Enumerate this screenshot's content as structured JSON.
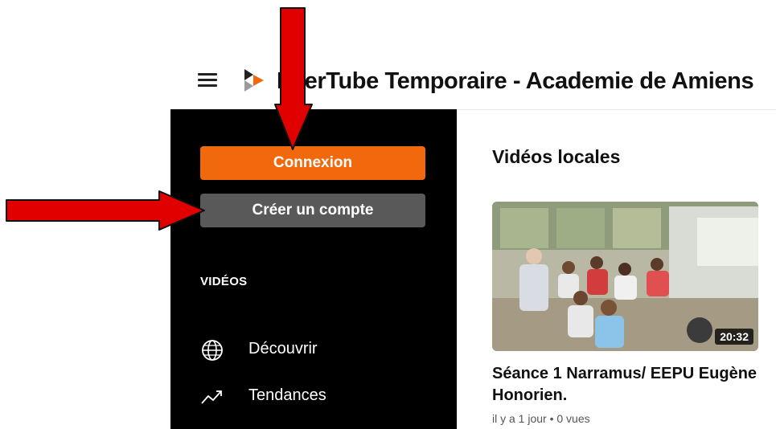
{
  "header": {
    "menu_icon": "hamburger-menu-icon",
    "logo_icon": "peertube-logo-icon",
    "title": "PeerTube Temporaire - Academie de Amiens"
  },
  "sidebar": {
    "login_label": "Connexion",
    "register_label": "Créer un compte",
    "section_title": "VIDÉOS",
    "items": [
      {
        "label": "Découvrir",
        "icon": "globe-icon"
      },
      {
        "label": "Tendances",
        "icon": "trending-up-icon"
      }
    ]
  },
  "main": {
    "heading": "Vidéos locales",
    "video": {
      "duration": "20:32",
      "title": "Séance 1 Narramus/ EEPU Eugène Honorien.",
      "meta": "il y a 1 jour • 0 vues"
    }
  },
  "colors": {
    "accent": "#f2690d",
    "register_button": "#595959",
    "sidebar_bg": "#000000",
    "annotation_arrow": "#e00000"
  }
}
